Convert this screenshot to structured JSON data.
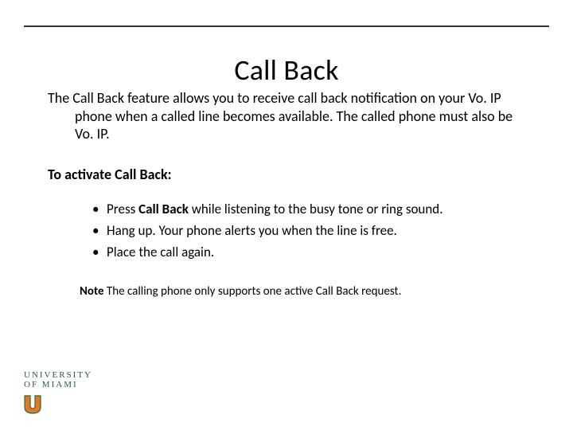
{
  "title": "Call Back",
  "intro": "The Call Back feature allows you to receive call back notification on your Vo. IP phone when a called line becomes available. The called phone must also be Vo. IP.",
  "section_heading": "To activate Call Back:",
  "steps": [
    {
      "pre": "Press ",
      "bold": "Call Back",
      "post": " while listening to the busy tone or ring sound."
    },
    {
      "pre": "Hang up. Your phone alerts you when the line is free.",
      "bold": "",
      "post": ""
    },
    {
      "pre": "Place the call again.",
      "bold": "",
      "post": ""
    }
  ],
  "note": {
    "lead": "Note",
    "text": " The calling phone only supports one active Call Back request."
  },
  "logo": {
    "line1": "UNIVERSITY",
    "line2": "OF MIAMI"
  }
}
